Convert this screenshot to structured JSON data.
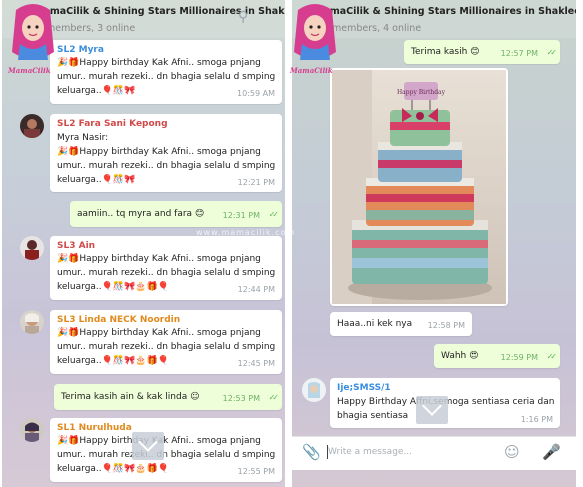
{
  "left_panel": {
    "title": "MamaCilik & Shining Stars Millionaires in Shaklee",
    "subtitle": "members, 3 online",
    "messages": [
      {
        "sender": "SL2 Myra",
        "sender_color": "#3a8dde",
        "lines": [
          "🎉🎁Happy birthday Kak Afni.. smoga pnjang",
          "umur.. murah rezeki.. dn bhagia selalu d smping",
          "keluarga..🎈🎊🎀"
        ],
        "time": "10:59 AM"
      },
      {
        "sender": "SL2 Fara Sani Kepong",
        "sender_color": "#d04a4a",
        "lines": [
          "Myra Nasir:",
          "🎉🎁Happy birthday Kak Afni.. smoga pnjang",
          "umur.. murah rezeki.. dn bhagia selalu d smping",
          "keluarga..🎈🎊🎀"
        ],
        "time": "12:21 PM"
      },
      {
        "text": "aamiin.. tq myra and fara 😊",
        "time": "12:31 PM"
      },
      {
        "sender": "SL3 Ain",
        "sender_color": "#d04a4a",
        "lines": [
          "🎉🎁Happy birthday Kak Afni.. smoga pnjang",
          "umur.. murah rezeki.. dn bhagia selalu d smping",
          "keluarga..🎈🎊🎀🎂🎁🎈"
        ],
        "time": "12:44 PM"
      },
      {
        "sender": "SL3 Linda NECK Noordin",
        "sender_color": "#e08a1e",
        "lines": [
          "🎉🎁Happy birthday Kak Afni.. smoga pnjang",
          "umur.. murah rezeki.. dn bhagia selalu d smping",
          "keluarga..🎈🎊🎀🎂🎁🎈"
        ],
        "time": "12:45 PM"
      },
      {
        "text": "Terima kasih ain & kak linda ☺",
        "time": "12:53 PM"
      },
      {
        "sender": "SL1 Nurulhuda",
        "sender_color": "#e08a1e",
        "lines": [
          "🎉🎁Happy birthday Kak Afni.. smoga pnjang",
          "umur.. murah rezeki.. dn bhagia selalu d smping",
          "keluarga..🎈🎊🎀🎂🎁🎈"
        ],
        "time": "12:55 PM"
      }
    ]
  },
  "right_panel": {
    "title": "MamaCilik & Shining Stars Millionaires in Shaklee",
    "subtitle": "members, 4 online",
    "messages": [
      {
        "text": "Terima kasih 😊",
        "time": "12:57 PM"
      },
      {
        "text": "Haaa..ni kek nya",
        "time": "12:58 PM"
      },
      {
        "text": "Wahh 😍",
        "time": "12:59 PM"
      },
      {
        "sender": "Ije;SMSS/1",
        "sender_color": "#3a8dde",
        "lines": [
          "Happy Birthday Affni,semoga sentiasa ceria dan",
          "bhagia sentiasa"
        ],
        "time": "1:16 PM"
      }
    ],
    "cake_sign": "Happy Birthday",
    "composer_placeholder": "Write a message..."
  },
  "brand": {
    "logo_text": "MamaCilik",
    "watermark": "www.mamacilik.com"
  },
  "icons": [
    "search-icon",
    "attach-icon",
    "emoji-icon",
    "microphone-icon",
    "chevron-down-icon",
    "double-check-icon"
  ],
  "colors": {
    "outgoing_bubble": "#eefed9",
    "incoming_bubble": "#ffffff",
    "check": "#5fb158",
    "link_blue": "#3a8dde"
  }
}
